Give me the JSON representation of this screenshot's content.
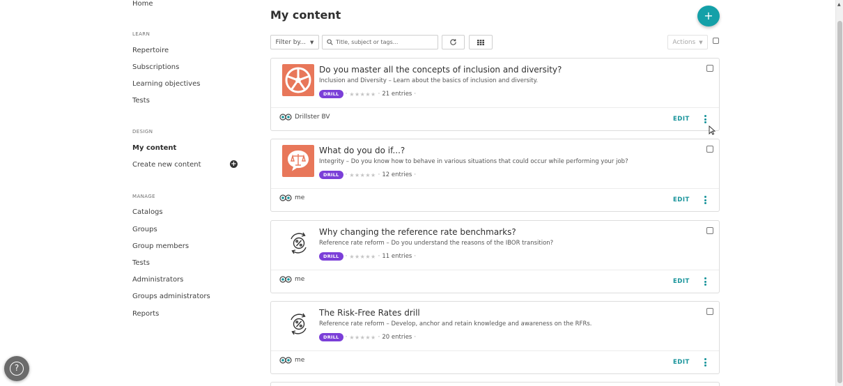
{
  "sidebar": {
    "home": "Home",
    "learn_heading": "LEARN",
    "learn_items": [
      "Repertoire",
      "Subscriptions",
      "Learning objectives",
      "Tests"
    ],
    "design_heading": "DESIGN",
    "design_items": [
      "My content",
      "Create new content"
    ],
    "manage_heading": "MANAGE",
    "manage_items": [
      "Catalogs",
      "Groups",
      "Group members",
      "Tests",
      "Administrators",
      "Groups administrators",
      "Reports"
    ]
  },
  "header": {
    "title": "My content",
    "add_label": "+"
  },
  "toolbar": {
    "filter_label": "Filter by...",
    "search_placeholder": "Title, subject or tags...",
    "actions_label": "Actions"
  },
  "cards": [
    {
      "title": "Do you master all the concepts of inclusion and diversity?",
      "subtitle": "Inclusion and Diversity – Learn about the basics of inclusion and diversity.",
      "badge": "DRILL",
      "entries": "21 entries",
      "owner": "Drillster BV",
      "edit": "EDIT",
      "icon": "inclusion-wheel-icon"
    },
    {
      "title": "What do you do if...?",
      "subtitle": "Integrity – Do you know how to behave in various situations that could occur while performing your job?",
      "badge": "DRILL",
      "entries": "12 entries",
      "owner": "me",
      "edit": "EDIT",
      "icon": "scales-speech-bubble-icon"
    },
    {
      "title": "Why changing the reference rate benchmarks?",
      "subtitle": "Reference rate reform – Do you understand the reasons of the IBOR transition?",
      "badge": "DRILL",
      "entries": "11 entries",
      "owner": "me",
      "edit": "EDIT",
      "icon": "percent-cycle-icon"
    },
    {
      "title": "The Risk-Free Rates drill",
      "subtitle": "Reference rate reform – Develop, anchor and retain knowledge and awareness on the RFRs.",
      "badge": "DRILL",
      "entries": "20 entries",
      "owner": "me",
      "edit": "EDIT",
      "icon": "percent-cycle-icon"
    }
  ],
  "help": {
    "label": "?"
  },
  "colors": {
    "accent": "#14a0a8",
    "badge": "#7b3fd8",
    "thumb_orange": "#e8775a"
  }
}
